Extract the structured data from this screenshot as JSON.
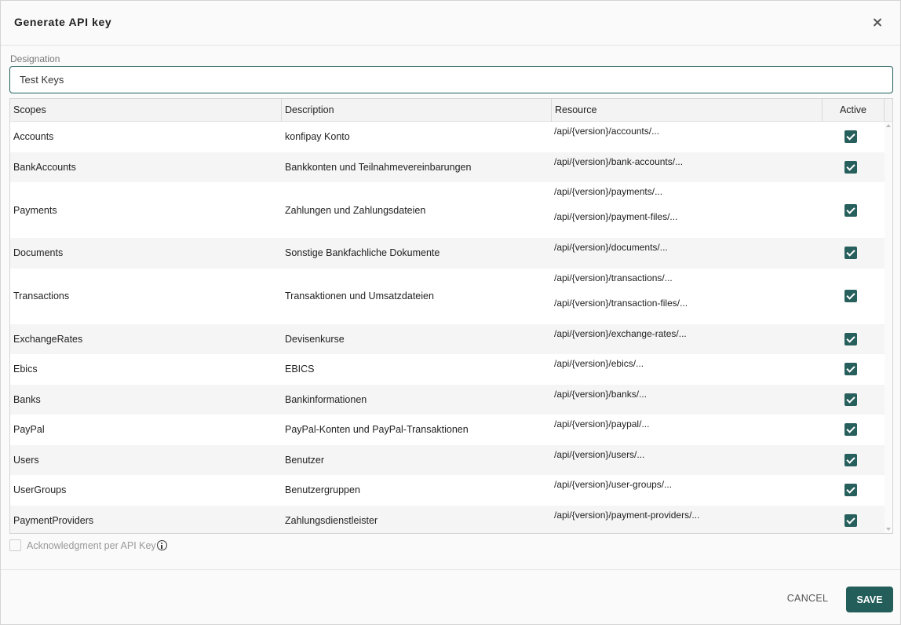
{
  "dialog": {
    "title": "Generate API key",
    "close_icon": "close-icon"
  },
  "designation": {
    "label": "Designation",
    "value": "Test Keys"
  },
  "table": {
    "headers": {
      "scopes": "Scopes",
      "description": "Description",
      "resource": "Resource",
      "active": "Active"
    },
    "rows": [
      {
        "scope": "Accounts",
        "description": "konfipay Konto",
        "resources": [
          "/api/{version}/accounts/..."
        ],
        "active": true
      },
      {
        "scope": "BankAccounts",
        "description": "Bankkonten und Teilnahmevereinbarungen",
        "resources": [
          "/api/{version}/bank-accounts/..."
        ],
        "active": true
      },
      {
        "scope": "Payments",
        "description": "Zahlungen und Zahlungsdateien",
        "resources": [
          "/api/{version}/payments/...",
          "/api/{version}/payment-files/..."
        ],
        "active": true
      },
      {
        "scope": "Documents",
        "description": "Sonstige Bankfachliche Dokumente",
        "resources": [
          "/api/{version}/documents/..."
        ],
        "active": true
      },
      {
        "scope": "Transactions",
        "description": "Transaktionen und Umsatzdateien",
        "resources": [
          "/api/{version}/transactions/...",
          "/api/{version}/transaction-files/..."
        ],
        "active": true
      },
      {
        "scope": "ExchangeRates",
        "description": "Devisenkurse",
        "resources": [
          "/api/{version}/exchange-rates/..."
        ],
        "active": true
      },
      {
        "scope": "Ebics",
        "description": "EBICS",
        "resources": [
          "/api/{version}/ebics/..."
        ],
        "active": true
      },
      {
        "scope": "Banks",
        "description": "Bankinformationen",
        "resources": [
          "/api/{version}/banks/..."
        ],
        "active": true
      },
      {
        "scope": "PayPal",
        "description": "PayPal-Konten und PayPal-Transaktionen",
        "resources": [
          "/api/{version}/paypal/..."
        ],
        "active": true
      },
      {
        "scope": "Users",
        "description": "Benutzer",
        "resources": [
          "/api/{version}/users/..."
        ],
        "active": true
      },
      {
        "scope": "UserGroups",
        "description": "Benutzergruppen",
        "resources": [
          "/api/{version}/user-groups/..."
        ],
        "active": true
      },
      {
        "scope": "PaymentProviders",
        "description": "Zahlungsdienstleister",
        "resources": [
          "/api/{version}/payment-providers/..."
        ],
        "active": true
      }
    ]
  },
  "acknowledgment": {
    "label": "Acknowledgment per API Key",
    "checked": false,
    "info_icon": "info-icon"
  },
  "footer": {
    "cancel_label": "CANCEL",
    "save_label": "SAVE"
  },
  "colors": {
    "accent": "#245e5a",
    "row_alt": "#f5f5f5"
  }
}
